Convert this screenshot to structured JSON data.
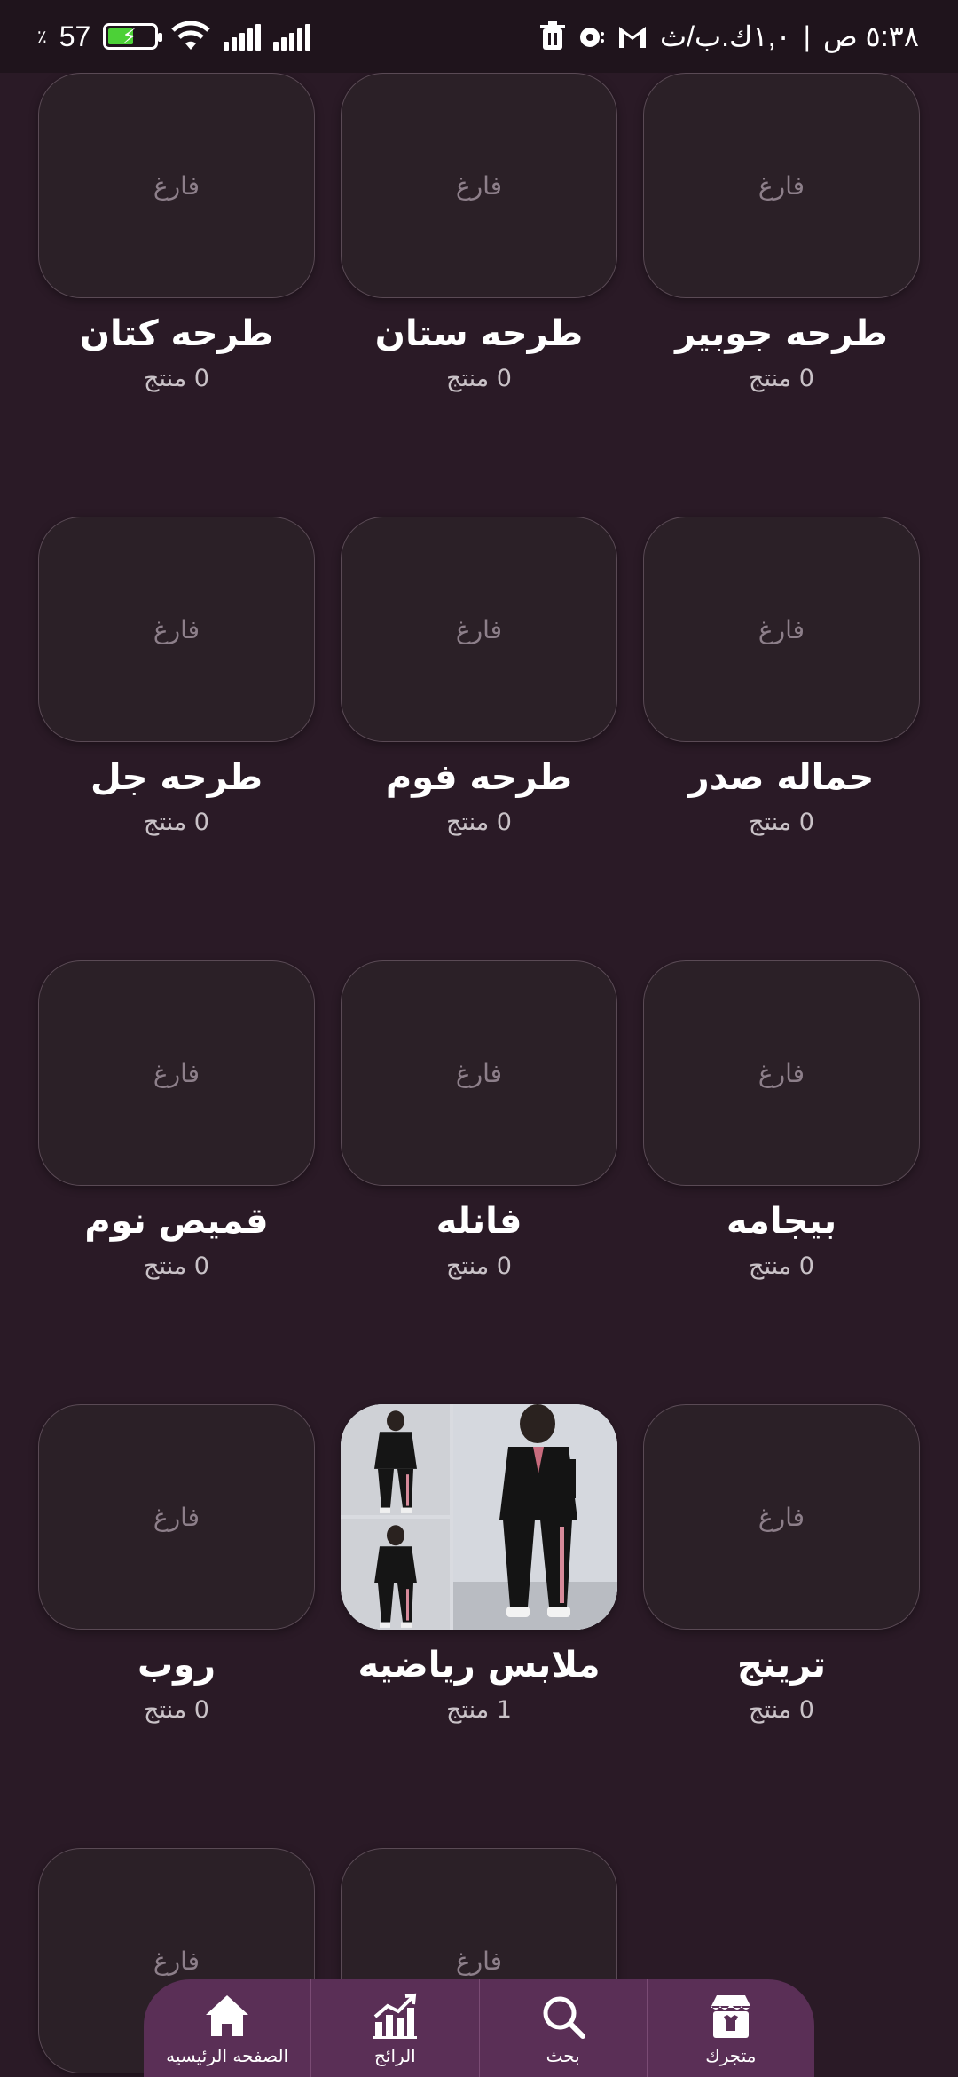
{
  "status_bar": {
    "time": "٥:٣٨ ص",
    "network_speed": "١,٠ك.ب/ث",
    "battery_level": "57",
    "battery_percent_sign": "٪"
  },
  "categories": [
    {
      "name": "طرحه جوبير",
      "count": "0 منتج",
      "thumbnail": "فارغ"
    },
    {
      "name": "طرحه ستان",
      "count": "0 منتج",
      "thumbnail": "فارغ"
    },
    {
      "name": "طرحه كتان",
      "count": "0 منتج",
      "thumbnail": "فارغ"
    },
    {
      "name": "حماله صدر",
      "count": "0 منتج",
      "thumbnail": "فارغ"
    },
    {
      "name": "طرحه فوم",
      "count": "0 منتج",
      "thumbnail": "فارغ"
    },
    {
      "name": "طرحه جل",
      "count": "0 منتج",
      "thumbnail": "فارغ"
    },
    {
      "name": "بيجامه",
      "count": "0 منتج",
      "thumbnail": "فارغ"
    },
    {
      "name": "فانله",
      "count": "0 منتج",
      "thumbnail": "فارغ"
    },
    {
      "name": "قميص نوم",
      "count": "0 منتج",
      "thumbnail": "فارغ"
    },
    {
      "name": "ترينج",
      "count": "0 منتج",
      "thumbnail": "فارغ"
    },
    {
      "name": "ملابس رياضيه",
      "count": "1 منتج",
      "thumbnail": ""
    },
    {
      "name": "روب",
      "count": "0 منتج",
      "thumbnail": "فارغ"
    },
    {
      "name": "",
      "count": "",
      "thumbnail": "فارغ"
    },
    {
      "name": "",
      "count": "",
      "thumbnail": "فارغ"
    }
  ],
  "bottom_nav": [
    {
      "label": "الصفحه الرئيسيه",
      "icon": "home-icon"
    },
    {
      "label": "الرائج",
      "icon": "trending-chart-icon"
    },
    {
      "label": "بحث",
      "icon": "search-icon"
    },
    {
      "label": "متجرك",
      "icon": "store-icon"
    }
  ]
}
